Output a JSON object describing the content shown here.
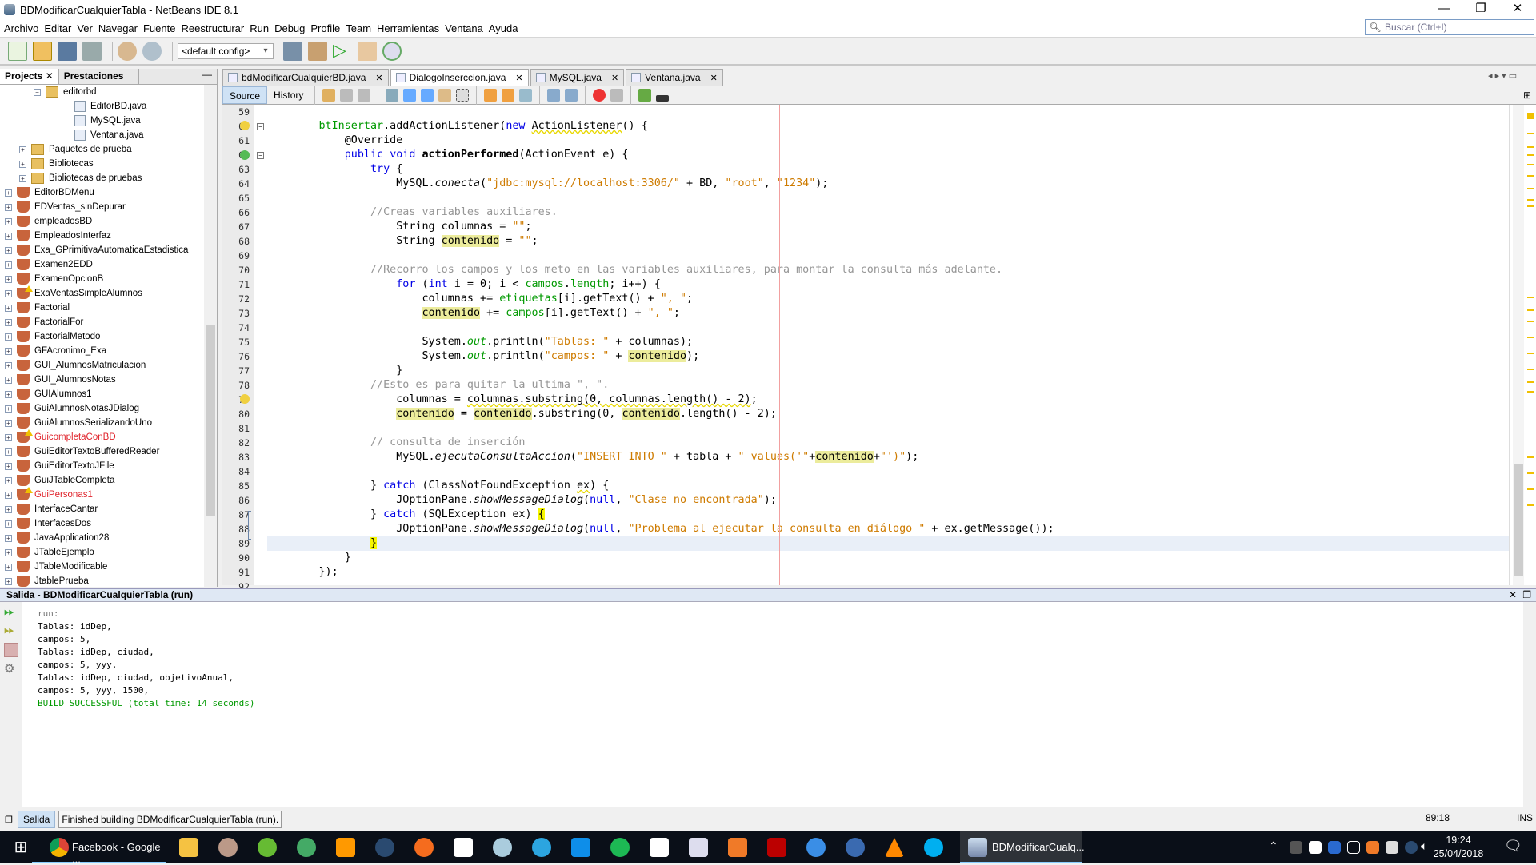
{
  "window": {
    "title": "BDModificarCualquierTabla - NetBeans IDE 8.1",
    "minimize": "—",
    "restore": "❐",
    "close": "✕"
  },
  "menu": [
    "Archivo",
    "Editar",
    "Ver",
    "Navegar",
    "Fuente",
    "Reestructurar",
    "Run",
    "Debug",
    "Profile",
    "Team",
    "Herramientas",
    "Ventana",
    "Ayuda"
  ],
  "search": {
    "placeholder": "Buscar (Ctrl+I)"
  },
  "toolbar": {
    "config": "<default config>"
  },
  "left_tabs": [
    "Projects",
    "Prestaciones"
  ],
  "tree": [
    {
      "label": "editorbd",
      "type": "package",
      "level": 2,
      "exp": "−"
    },
    {
      "label": "EditorBD.java",
      "type": "java",
      "level": 3
    },
    {
      "label": "MySQL.java",
      "type": "java",
      "level": 3
    },
    {
      "label": "Ventana.java",
      "type": "java",
      "level": 3
    },
    {
      "label": "Paquetes de prueba",
      "type": "folder",
      "level": 1,
      "exp": "+"
    },
    {
      "label": "Bibliotecas",
      "type": "folder",
      "level": 1,
      "exp": "+"
    },
    {
      "label": "Bibliotecas de pruebas",
      "type": "folder",
      "level": 1,
      "exp": "+"
    },
    {
      "label": "EditorBDMenu",
      "type": "project",
      "level": 0,
      "exp": "+"
    },
    {
      "label": "EDVentas_sinDepurar",
      "type": "project",
      "level": 0,
      "exp": "+"
    },
    {
      "label": "empleadosBD",
      "type": "project",
      "level": 0,
      "exp": "+"
    },
    {
      "label": "EmpleadosInterfaz",
      "type": "project",
      "level": 0,
      "exp": "+"
    },
    {
      "label": "Exa_GPrimitivaAutomaticaEstadistica",
      "type": "project",
      "level": 0,
      "exp": "+"
    },
    {
      "label": "Examen2EDD",
      "type": "project",
      "level": 0,
      "exp": "+"
    },
    {
      "label": "ExamenOpcionB",
      "type": "project",
      "level": 0,
      "exp": "+"
    },
    {
      "label": "ExaVentasSimpleAlumnos",
      "type": "project",
      "level": 0,
      "exp": "+",
      "warn": true
    },
    {
      "label": "Factorial",
      "type": "project",
      "level": 0,
      "exp": "+"
    },
    {
      "label": "FactorialFor",
      "type": "project",
      "level": 0,
      "exp": "+"
    },
    {
      "label": "FactorialMetodo",
      "type": "project",
      "level": 0,
      "exp": "+"
    },
    {
      "label": "GFAcronimo_Exa",
      "type": "project",
      "level": 0,
      "exp": "+"
    },
    {
      "label": "GUI_AlumnosMatriculacion",
      "type": "project",
      "level": 0,
      "exp": "+"
    },
    {
      "label": "GUI_AlumnosNotas",
      "type": "project",
      "level": 0,
      "exp": "+"
    },
    {
      "label": "GUIAlumnos1",
      "type": "project",
      "level": 0,
      "exp": "+"
    },
    {
      "label": "GuiAlumnosNotasJDialog",
      "type": "project",
      "level": 0,
      "exp": "+"
    },
    {
      "label": "GuiAlumnosSerializandoUno",
      "type": "project",
      "level": 0,
      "exp": "+"
    },
    {
      "label": "GuicompletaConBD",
      "type": "project",
      "level": 0,
      "exp": "+",
      "error": true,
      "warn": true
    },
    {
      "label": "GuiEditorTextoBufferedReader",
      "type": "project",
      "level": 0,
      "exp": "+"
    },
    {
      "label": "GuiEditorTextoJFile",
      "type": "project",
      "level": 0,
      "exp": "+"
    },
    {
      "label": "GuiJTableCompleta",
      "type": "project",
      "level": 0,
      "exp": "+"
    },
    {
      "label": "GuiPersonas1",
      "type": "project",
      "level": 0,
      "exp": "+",
      "error": true,
      "warn": true
    },
    {
      "label": "InterfaceCantar",
      "type": "project",
      "level": 0,
      "exp": "+"
    },
    {
      "label": "InterfacesDos",
      "type": "project",
      "level": 0,
      "exp": "+"
    },
    {
      "label": "JavaApplication28",
      "type": "project",
      "level": 0,
      "exp": "+"
    },
    {
      "label": "JTableEjemplo",
      "type": "project",
      "level": 0,
      "exp": "+"
    },
    {
      "label": "JTableModificable",
      "type": "project",
      "level": 0,
      "exp": "+"
    },
    {
      "label": "JtablePrueba",
      "type": "project",
      "level": 0,
      "exp": "+"
    }
  ],
  "editor_tabs": [
    {
      "label": "bdModificarCualquierBD.java"
    },
    {
      "label": "DialogoInserccion.java",
      "active": true
    },
    {
      "label": "MySQL.java"
    },
    {
      "label": "Ventana.java"
    }
  ],
  "editor_modes": [
    "Source",
    "History"
  ],
  "code": [
    {
      "n": "59",
      "t": []
    },
    {
      "n": "60",
      "t": [
        [
          "p",
          "        "
        ],
        [
          "f",
          "btInsertar"
        ],
        [
          "p",
          ".addActionListener("
        ],
        [
          "k",
          "new"
        ],
        [
          "p",
          " "
        ],
        [
          "w",
          "ActionListener"
        ],
        [
          "p",
          "() {"
        ]
      ]
    },
    {
      "n": "61",
      "t": [
        [
          "p",
          "            @Override"
        ]
      ]
    },
    {
      "n": "62",
      "t": [
        [
          "p",
          "            "
        ],
        [
          "k",
          "public"
        ],
        [
          "p",
          " "
        ],
        [
          "k",
          "void"
        ],
        [
          "p",
          " "
        ],
        [
          "b",
          "actionPerformed"
        ],
        [
          "p",
          "(ActionEvent e) {"
        ]
      ]
    },
    {
      "n": "63",
      "t": [
        [
          "p",
          "                "
        ],
        [
          "k",
          "try"
        ],
        [
          "p",
          " {"
        ]
      ]
    },
    {
      "n": "64",
      "t": [
        [
          "p",
          "                    MySQL."
        ],
        [
          "i",
          "conecta"
        ],
        [
          "p",
          "("
        ],
        [
          "s",
          "\"jdbc:mysql://localhost:3306/\""
        ],
        [
          "p",
          " + BD, "
        ],
        [
          "s",
          "\"root\""
        ],
        [
          "p",
          ", "
        ],
        [
          "s",
          "\"1234\""
        ],
        [
          "p",
          ");"
        ]
      ]
    },
    {
      "n": "65",
      "t": []
    },
    {
      "n": "66",
      "t": [
        [
          "p",
          "                "
        ],
        [
          "c",
          "//Creas variables auxiliares."
        ]
      ]
    },
    {
      "n": "67",
      "t": [
        [
          "p",
          "                    String columnas = "
        ],
        [
          "s",
          "\"\""
        ],
        [
          "p",
          ";"
        ]
      ]
    },
    {
      "n": "68",
      "t": [
        [
          "p",
          "                    String "
        ],
        [
          "h",
          "contenido"
        ],
        [
          "p",
          " = "
        ],
        [
          "s",
          "\"\""
        ],
        [
          "p",
          ";"
        ]
      ]
    },
    {
      "n": "69",
      "t": []
    },
    {
      "n": "70",
      "t": [
        [
          "p",
          "                "
        ],
        [
          "c",
          "//Recorro los campos y los meto en las variables auxiliares, para montar la consulta más adelante."
        ]
      ]
    },
    {
      "n": "71",
      "t": [
        [
          "p",
          "                    "
        ],
        [
          "k",
          "for"
        ],
        [
          "p",
          " ("
        ],
        [
          "k",
          "int"
        ],
        [
          "p",
          " i = 0; i < "
        ],
        [
          "f",
          "campos"
        ],
        [
          "p",
          "."
        ],
        [
          "f",
          "length"
        ],
        [
          "p",
          "; i++) {"
        ]
      ]
    },
    {
      "n": "72",
      "t": [
        [
          "p",
          "                        columnas += "
        ],
        [
          "f",
          "etiquetas"
        ],
        [
          "p",
          "[i].getText() + "
        ],
        [
          "s",
          "\", \""
        ],
        [
          "p",
          ";"
        ]
      ]
    },
    {
      "n": "73",
      "t": [
        [
          "p",
          "                        "
        ],
        [
          "h",
          "contenido"
        ],
        [
          "p",
          " += "
        ],
        [
          "f",
          "campos"
        ],
        [
          "p",
          "[i].getText() + "
        ],
        [
          "s",
          "\", \""
        ],
        [
          "p",
          ";"
        ]
      ]
    },
    {
      "n": "74",
      "t": []
    },
    {
      "n": "75",
      "t": [
        [
          "p",
          "                        System."
        ],
        [
          "fi",
          "out"
        ],
        [
          "p",
          ".println("
        ],
        [
          "s",
          "\"Tablas: \""
        ],
        [
          "p",
          " + columnas);"
        ]
      ]
    },
    {
      "n": "76",
      "t": [
        [
          "p",
          "                        System."
        ],
        [
          "fi",
          "out"
        ],
        [
          "p",
          ".println("
        ],
        [
          "s",
          "\"campos: \""
        ],
        [
          "p",
          " + "
        ],
        [
          "h",
          "contenido"
        ],
        [
          "p",
          ");"
        ]
      ]
    },
    {
      "n": "77",
      "t": [
        [
          "p",
          "                    }"
        ]
      ]
    },
    {
      "n": "78",
      "t": [
        [
          "p",
          "                "
        ],
        [
          "c",
          "//Esto es para quitar la ultima \", \"."
        ]
      ]
    },
    {
      "n": "79",
      "t": [
        [
          "p",
          "                    columnas = "
        ],
        [
          "w",
          "columnas.substring(0, columnas.length() - 2)"
        ],
        [
          "p",
          ";"
        ]
      ]
    },
    {
      "n": "80",
      "t": [
        [
          "p",
          "                    "
        ],
        [
          "h",
          "contenido"
        ],
        [
          "p",
          " = "
        ],
        [
          "h",
          "contenido"
        ],
        [
          "p",
          ".substring(0, "
        ],
        [
          "h",
          "contenido"
        ],
        [
          "p",
          ".length() - 2);"
        ]
      ]
    },
    {
      "n": "81",
      "t": []
    },
    {
      "n": "82",
      "t": [
        [
          "p",
          "                "
        ],
        [
          "c",
          "// consulta de inserción"
        ]
      ]
    },
    {
      "n": "83",
      "t": [
        [
          "p",
          "                    MySQL."
        ],
        [
          "i",
          "ejecutaConsultaAccion"
        ],
        [
          "p",
          "("
        ],
        [
          "s",
          "\"INSERT INTO \""
        ],
        [
          "p",
          " + tabla + "
        ],
        [
          "s",
          "\" values('\""
        ],
        [
          "p",
          "+"
        ],
        [
          "h",
          "contenido"
        ],
        [
          "p",
          "+"
        ],
        [
          "s",
          "\"')\""
        ],
        [
          "p",
          ");"
        ]
      ]
    },
    {
      "n": "84",
      "t": []
    },
    {
      "n": "85",
      "t": [
        [
          "p",
          "                } "
        ],
        [
          "k",
          "catch"
        ],
        [
          "p",
          " (ClassNotFoundException "
        ],
        [
          "w",
          "ex"
        ],
        [
          "p",
          ") {"
        ]
      ]
    },
    {
      "n": "86",
      "t": [
        [
          "p",
          "                    JOptionPane."
        ],
        [
          "i",
          "showMessageDialog"
        ],
        [
          "p",
          "("
        ],
        [
          "k",
          "null"
        ],
        [
          "p",
          ", "
        ],
        [
          "s",
          "\"Clase no encontrada\""
        ],
        [
          "p",
          ");"
        ]
      ]
    },
    {
      "n": "87",
      "t": [
        [
          "p",
          "                } "
        ],
        [
          "k",
          "catch"
        ],
        [
          "p",
          " (SQLException ex) "
        ],
        [
          "m",
          "{"
        ]
      ]
    },
    {
      "n": "88",
      "t": [
        [
          "p",
          "                    JOptionPane."
        ],
        [
          "i",
          "showMessageDialog"
        ],
        [
          "p",
          "("
        ],
        [
          "k",
          "null"
        ],
        [
          "p",
          ", "
        ],
        [
          "s",
          "\"Problema al ejecutar la consulta en diálogo \""
        ],
        [
          "p",
          " + ex.getMessage());"
        ]
      ]
    },
    {
      "n": "89",
      "t": [
        [
          "p",
          "                "
        ],
        [
          "m",
          "}"
        ]
      ],
      "current": true
    },
    {
      "n": "90",
      "t": [
        [
          "p",
          "            }"
        ]
      ]
    },
    {
      "n": "91",
      "t": [
        [
          "p",
          "        });"
        ]
      ]
    },
    {
      "n": "92",
      "t": []
    }
  ],
  "output": {
    "title": "Salida - BDModificarCualquierTabla (run)",
    "lines": [
      {
        "text": "run:",
        "color": "#777777"
      },
      {
        "text": "Tablas: idDep,"
      },
      {
        "text": "campos: 5,"
      },
      {
        "text": "Tablas: idDep, ciudad,"
      },
      {
        "text": "campos: 5, yyy,"
      },
      {
        "text": "Tablas: idDep, ciudad, objetivoAnual,"
      },
      {
        "text": "campos: 5, yyy, 1500,"
      },
      {
        "text": "BUILD SUCCESSFUL (total time: 14 seconds)",
        "color": "#009900"
      }
    ]
  },
  "status": {
    "output_tab": "Salida",
    "message": "Finished building BDModificarCualquierTabla (run).",
    "caret": "89:18",
    "mode": "INS"
  },
  "taskbar": {
    "chrome_label": "Facebook - Google ...",
    "netbeans_label": "BDModificarCualq...",
    "time": "19:24",
    "date": "25/04/2018"
  },
  "colors": {
    "keyword": "#0000e6",
    "string": "#ce7b00",
    "comment": "#969696",
    "field": "#009900",
    "highlight": "#ecec9c"
  }
}
